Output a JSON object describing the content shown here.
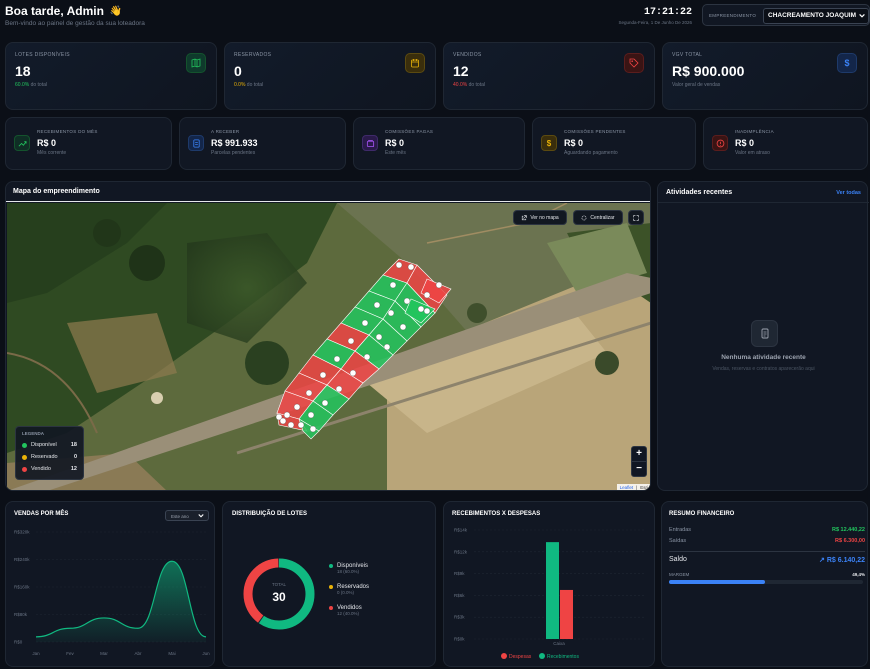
{
  "header": {
    "greeting": "Boa tarde, Admin",
    "wave_emoji": "👋",
    "subtitle": "Bem-vindo ao painel de gestão da sua loteadora",
    "clock": "17:21:22",
    "date": "Segunda-Feira, 1 De Junho De 2026",
    "empreendimento_label": "EMPREENDIMENTO",
    "empreendimento_value": "CHACREAMENTO JOAQUIM"
  },
  "stats": [
    {
      "label": "LOTES DISPONÍVEIS",
      "value": "18",
      "pct": "60.0%",
      "suffix": " do total",
      "pct_color": "#22c55e",
      "icon": "map-icon"
    },
    {
      "label": "RESERVADOS",
      "value": "0",
      "pct": "0.0%",
      "suffix": " do total",
      "pct_color": "#eab308",
      "icon": "calendar-icon"
    },
    {
      "label": "VENDIDOS",
      "value": "12",
      "pct": "40.0%",
      "suffix": " do total",
      "pct_color": "#ef4444",
      "icon": "tag-icon"
    },
    {
      "label": "VGV TOTAL",
      "value": "R$ 900.000",
      "sub": "Valor geral de vendas",
      "icon": "dollar-icon"
    }
  ],
  "mini": [
    {
      "label": "RECEBIMENTOS DO MÊS",
      "value": "R$ 0",
      "sub": "Mês corrente",
      "icon": "trend-icon"
    },
    {
      "label": "A RECEBER",
      "value": "R$ 991.933",
      "sub": "Parcelas pendentes",
      "icon": "document-icon"
    },
    {
      "label": "COMISSÕES PAGAS",
      "value": "R$ 0",
      "sub": "Este mês",
      "icon": "wallet-icon"
    },
    {
      "label": "COMISSÕES PENDENTES",
      "value": "R$ 0",
      "sub": "Aguardando pagamento",
      "icon": "coin-icon"
    },
    {
      "label": "INADIMPLÊNCIA",
      "value": "R$ 0",
      "sub": "Valor em atraso",
      "icon": "alert-icon"
    }
  ],
  "map": {
    "title": "Mapa do empreendimento",
    "ver_no_mapa": "Ver no mapa",
    "centralizar": "Centralizar",
    "legend_title": "LEGENDA",
    "legend": [
      {
        "label": "Disponível",
        "count": "18",
        "color": "#22c55e"
      },
      {
        "label": "Reservado",
        "count": "0",
        "color": "#eab308"
      },
      {
        "label": "Vendido",
        "count": "12",
        "color": "#ef4444"
      }
    ],
    "zoom_in": "+",
    "zoom_out": "−",
    "attribution_leaflet": "Leaflet",
    "attribution_esri": "Esri"
  },
  "activities": {
    "title": "Atividades recentes",
    "link": "Ver todas",
    "empty_title": "Nenhuma atividade recente",
    "empty_sub": "Vendas, reservas e contratos aparecerão aqui"
  },
  "vendas_chart": {
    "title": "VENDAS POR MÊS",
    "filter": "Este ano",
    "chart_data": {
      "type": "area",
      "x": [
        "Jan",
        "Fev",
        "Mar",
        "Abr",
        "Mai",
        "Jun"
      ],
      "yticks": [
        "R$0",
        "R$80k",
        "R$160k",
        "R$240k",
        "R$320k"
      ],
      "ylim": [
        0,
        320000
      ],
      "series": [
        {
          "values": [
            15000,
            40000,
            70000,
            40000,
            235000,
            15000
          ],
          "color": "#10b981"
        }
      ]
    }
  },
  "distrib": {
    "title": "DISTRIBUIÇÃO DE LOTES",
    "total_label": "TOTAL",
    "total": "30",
    "chart_data": {
      "type": "pie",
      "slices": [
        {
          "label": "Disponíveis",
          "value": 18,
          "detail": "18 (60.0%)",
          "color": "#10b981"
        },
        {
          "label": "Reservados",
          "value": 0,
          "detail": "0 (0.0%)",
          "color": "#eab308"
        },
        {
          "label": "Vendidos",
          "value": 12,
          "detail": "12 (40.0%)",
          "color": "#ef4444"
        }
      ]
    }
  },
  "recebdesp": {
    "title": "RECEBIMENTOS X DESPESAS",
    "chart_data": {
      "type": "bar",
      "categories": [
        "Caixa"
      ],
      "yticks": [
        "R$0k",
        "R$3k",
        "R$6k",
        "R$9k",
        "R$12k",
        "R$14k"
      ],
      "ylim": [
        0,
        14000
      ],
      "series": [
        {
          "name": "Recebimentos",
          "values": [
            12440.22
          ],
          "color": "#10b981"
        },
        {
          "name": "Despesas",
          "values": [
            6300
          ],
          "color": "#ef4444"
        }
      ]
    }
  },
  "resumo": {
    "title": "RESUMO FINANCEIRO",
    "entradas_label": "Entradas",
    "entradas": "R$ 12.440,22",
    "saidas_label": "Saídas",
    "saidas": "R$ 6.300,00",
    "saldo_label": "Saldo",
    "saldo": "↗ R$ 6.140,22",
    "margem_label": "MARGEM",
    "margem": "49,4%",
    "margem_value": 0.494
  }
}
